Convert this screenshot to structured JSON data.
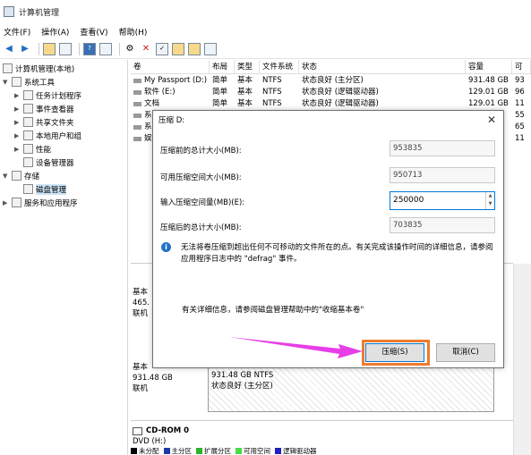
{
  "window": {
    "title": "计算机管理"
  },
  "menu": [
    "文件(F)",
    "操作(A)",
    "查看(V)",
    "帮助(H)"
  ],
  "tree": {
    "root": "计算机管理(本地)",
    "system_tools": "系统工具",
    "items": [
      "任务计划程序",
      "事件查看器",
      "共享文件夹",
      "本地用户和组",
      "性能",
      "设备管理器"
    ],
    "storage": "存储",
    "disk_mgmt": "磁盘管理",
    "services": "服务和应用程序"
  },
  "volumes": {
    "headers": [
      "卷",
      "布局",
      "类型",
      "文件系统",
      "状态",
      "容量",
      "可"
    ],
    "rows": [
      [
        "My Passport (D:)",
        "简单",
        "基本",
        "NTFS",
        "状态良好 (主分区)",
        "931.48 GB",
        "93"
      ],
      [
        "软件 (E:)",
        "简单",
        "基本",
        "NTFS",
        "状态良好 (逻辑驱动器)",
        "129.01 GB",
        "96"
      ],
      [
        "文档",
        "简单",
        "基本",
        "NTFS",
        "状态良好 (逻辑驱动器)",
        "129.01 GB",
        "11"
      ],
      [
        "系",
        "",
        "",
        "",
        "",
        "",
        "55"
      ],
      [
        "系",
        "",
        "",
        "",
        "",
        "",
        "65"
      ],
      [
        "娱",
        "",
        "",
        "",
        "",
        "",
        "11"
      ]
    ]
  },
  "disks": {
    "disk0": {
      "line1": "基本",
      "line2": "465.",
      "line3": "联机"
    },
    "disk1": {
      "line1": "基本",
      "line2": "931.48 GB",
      "line3": "联机"
    },
    "partition": {
      "size": "931.48 GB NTFS",
      "status": "状态良好 (主分区)"
    },
    "cdrom": {
      "name": "CD-ROM 0",
      "drive": "DVD (H:)"
    }
  },
  "legend": [
    {
      "label": "未分配",
      "color": "#000000"
    },
    {
      "label": "主分区",
      "color": "#1c3aa6"
    },
    {
      "label": "扩展分区",
      "color": "#2bb52b"
    },
    {
      "label": "可用空间",
      "color": "#44dd44"
    },
    {
      "label": "逻辑驱动器",
      "color": "#2020c0"
    }
  ],
  "dialog": {
    "title": "压缩 D:",
    "total_before_label": "压缩前的总计大小(MB):",
    "total_before_value": "953835",
    "available_label": "可用压缩空间大小(MB):",
    "available_value": "950713",
    "input_label": "输入压缩空间量(MB)(E):",
    "input_value": "250000",
    "total_after_label": "压缩后的总计大小(MB):",
    "total_after_value": "703835",
    "info": "无法将卷压缩到超出任何不可移动的文件所在的点。有关完成该操作时间的详细信息，请参阅应用程序日志中的 \"defrag\" 事件。",
    "help": "有关详细信息，请参阅磁盘管理帮助中的\"收缩基本卷\"",
    "shrink_button": "压缩(S)",
    "cancel_button": "取消(C)"
  }
}
